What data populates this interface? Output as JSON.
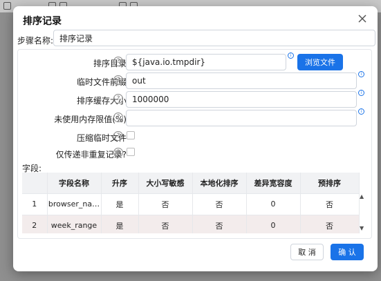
{
  "dialog": {
    "title": "排序记录",
    "close_icon": "close-icon"
  },
  "step": {
    "label": "步骤名称:",
    "value": "排序记录"
  },
  "form": {
    "sort_dir": {
      "label": "排序目录",
      "value": "${java.io.tmpdir}",
      "browse_label": "浏览文件"
    },
    "temp_prefix": {
      "label": "临时文件前缀",
      "value": "out"
    },
    "cache_size": {
      "label": "排序缓存大小",
      "value": "1000000"
    },
    "free_memory": {
      "label": "未使用内存限值(%)",
      "value": ""
    },
    "compress": {
      "label": "压缩临时文件",
      "checked": false
    },
    "unique_only": {
      "label": "仅传递非重复记录?",
      "checked": false
    },
    "help_icon": "?",
    "info_icon": "i"
  },
  "fields": {
    "label": "字段:",
    "columns": [
      "",
      "字段名称",
      "升序",
      "大小写敏感",
      "本地化排序",
      "差异宽容度",
      "预排序"
    ],
    "rows": [
      [
        "1",
        "browser_na…",
        "是",
        "否",
        "否",
        "0",
        "否"
      ],
      [
        "2",
        "week_range",
        "是",
        "否",
        "否",
        "0",
        "否"
      ]
    ],
    "scroll_up_icon": "▲",
    "scroll_down_icon": "▼"
  },
  "footer": {
    "cancel_label": "取 消",
    "ok_label": "确 认"
  },
  "colors": {
    "accent": "#1a73e8",
    "selected_row": "#f3ecec"
  }
}
